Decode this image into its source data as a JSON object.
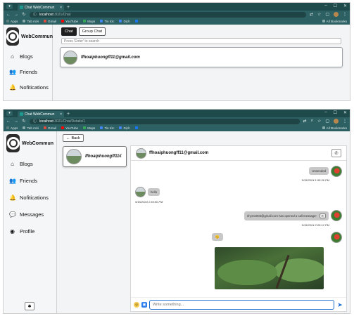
{
  "browser": {
    "tab_title": "Chat WebCommun",
    "new_tab_label": "+",
    "url_host_1": "localhost",
    "url_path_1": ":3021/Chat",
    "url_host_2": "localhost",
    "url_path_2": ":3021/Chat/Details/1",
    "bookmarks": [
      {
        "label": "Apps",
        "color": "#5f7f80"
      },
      {
        "label": "Tab mới",
        "color": "#8aa"
      },
      {
        "label": "Gmail",
        "color": "#e04a3f"
      },
      {
        "label": "YouTube",
        "color": "#ff0000"
      },
      {
        "label": "Maps",
        "color": "#34a853"
      },
      {
        "label": "Tin tức",
        "color": "#4285f4"
      },
      {
        "label": "Dịch",
        "color": "#4285f4"
      }
    ],
    "all_bookmarks": "All Bookmarks"
  },
  "brand": {
    "name": "WebCommun"
  },
  "sidebar1": {
    "items": [
      {
        "label": "Blogs",
        "icon": "home-icon"
      },
      {
        "label": "Friends",
        "icon": "friends-icon"
      },
      {
        "label": "Nofitications",
        "icon": "bell-icon"
      }
    ]
  },
  "sidebar2": {
    "items": [
      {
        "label": "Blogs",
        "icon": "home-icon"
      },
      {
        "label": "Friends",
        "icon": "friends-icon"
      },
      {
        "label": "Nofitications",
        "icon": "bell-icon"
      },
      {
        "label": "Messages",
        "icon": "messages-icon"
      },
      {
        "label": "Profile",
        "icon": "profile-icon"
      }
    ]
  },
  "chat_list": {
    "tabs": [
      "Chat",
      "Group Chat"
    ],
    "search_placeholder": "Press 'Enter' to search",
    "conversation_name": "ffhoaiphuongff11@gmail.com"
  },
  "chat_detail": {
    "back_label": "Back",
    "conv_card_name": "ffhoaiphuongff11€",
    "header_name": "ffhoaiphuongff11@gmail.com",
    "messages": [
      {
        "side": "right",
        "text": "Unsended",
        "time": "5/15/2024 1:55:36 PM"
      },
      {
        "side": "left",
        "text": "hello",
        "time": "5/15/2024 1:55:50 PM"
      },
      {
        "side": "right",
        "text": "nhym2003@gmail.com has opened a call message!",
        "time": "5/15/2024 2:05:12 PM"
      }
    ],
    "input_placeholder": "Write something..."
  }
}
